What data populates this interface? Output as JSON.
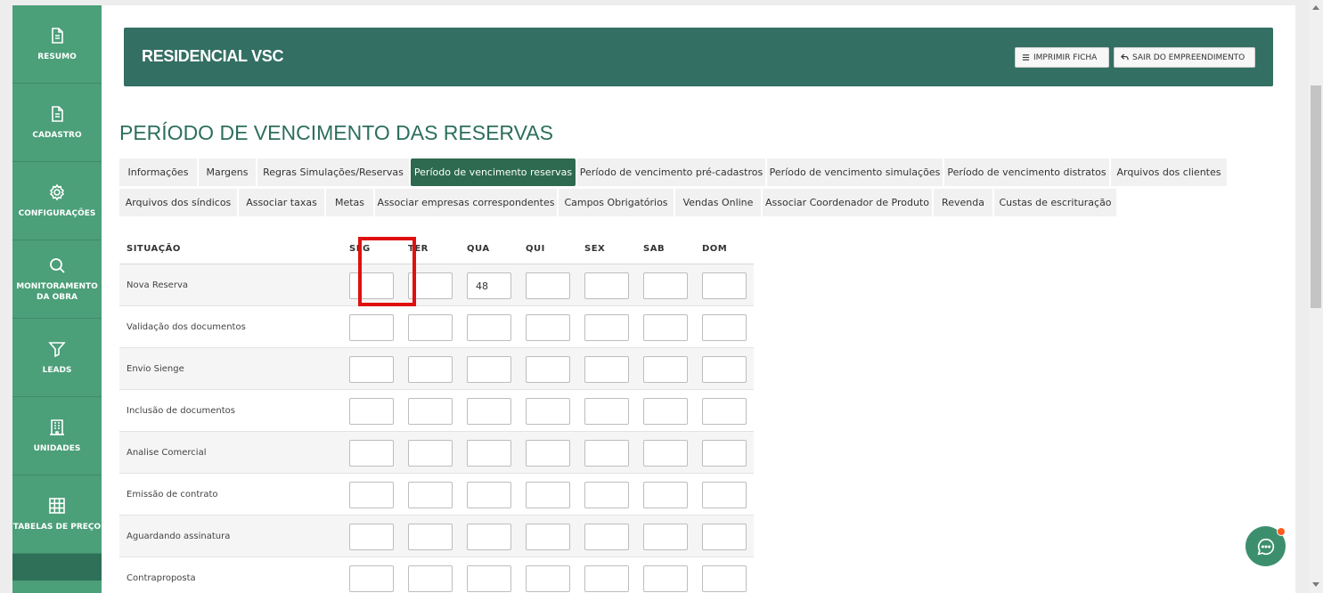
{
  "sidebar": {
    "items": [
      {
        "label": "RESUMO",
        "icon": "document-icon"
      },
      {
        "label": "CADASTRO",
        "icon": "document-icon"
      },
      {
        "label": "CONFIGURAÇÕES",
        "icon": "gear-icon"
      },
      {
        "label": "MONITORAMENTO DA OBRA",
        "icon": "search-icon"
      },
      {
        "label": "LEADS",
        "icon": "funnel-icon"
      },
      {
        "label": "UNIDADES",
        "icon": "building-icon"
      },
      {
        "label": "TABELAS DE PREÇO",
        "icon": "table-icon"
      }
    ]
  },
  "header": {
    "title": "RESIDENCIAL VSC",
    "print_label": "IMPRIMIR FICHA",
    "exit_label": "SAIR DO EMPREENDIMENTO"
  },
  "page_title": "PERÍODO DE VENCIMENTO DAS RESERVAS",
  "tabs": {
    "row1": [
      "Informações",
      "Margens",
      "Regras Simulações/Reservas",
      "Período de vencimento reservas",
      "Período de vencimento pré-cadastros",
      "Período de vencimento simulações",
      "Período de vencimento distratos",
      "Arquivos dos clientes"
    ],
    "row2": [
      "Arquivos dos síndicos",
      "Associar taxas",
      "Metas",
      "Associar empresas correspondentes",
      "Campos Obrigatórios",
      "Vendas Online",
      "Associar Coordenador de Produto",
      "Revenda",
      "Custas de escrituração"
    ],
    "active": "Período de vencimento reservas"
  },
  "table": {
    "headers": [
      "SITUAÇÃO",
      "SEG",
      "TER",
      "QUA",
      "QUI",
      "SEX",
      "SAB",
      "DOM"
    ],
    "rows": [
      {
        "label": "Nova Reserva",
        "values": [
          "",
          "",
          "48",
          "",
          "",
          "",
          ""
        ]
      },
      {
        "label": "Validação dos documentos",
        "values": [
          "",
          "",
          "",
          "",
          "",
          "",
          ""
        ]
      },
      {
        "label": "Envio Sienge",
        "values": [
          "",
          "",
          "",
          "",
          "",
          "",
          ""
        ]
      },
      {
        "label": "Inclusão de documentos",
        "values": [
          "",
          "",
          "",
          "",
          "",
          "",
          ""
        ]
      },
      {
        "label": "Analise Comercial",
        "values": [
          "",
          "",
          "",
          "",
          "",
          "",
          ""
        ]
      },
      {
        "label": "Emissão de contrato",
        "values": [
          "",
          "",
          "",
          "",
          "",
          "",
          ""
        ]
      },
      {
        "label": "Aguardando assinatura",
        "values": [
          "",
          "",
          "",
          "",
          "",
          "",
          ""
        ]
      },
      {
        "label": "Contraproposta",
        "values": [
          "",
          "",
          "",
          "",
          "",
          "",
          ""
        ]
      }
    ]
  },
  "colors": {
    "sidebar": "#4b9f79",
    "header": "#336f63",
    "title": "#2c6e5d",
    "active_tab": "#2d6a4f",
    "highlight": "#e01010"
  }
}
